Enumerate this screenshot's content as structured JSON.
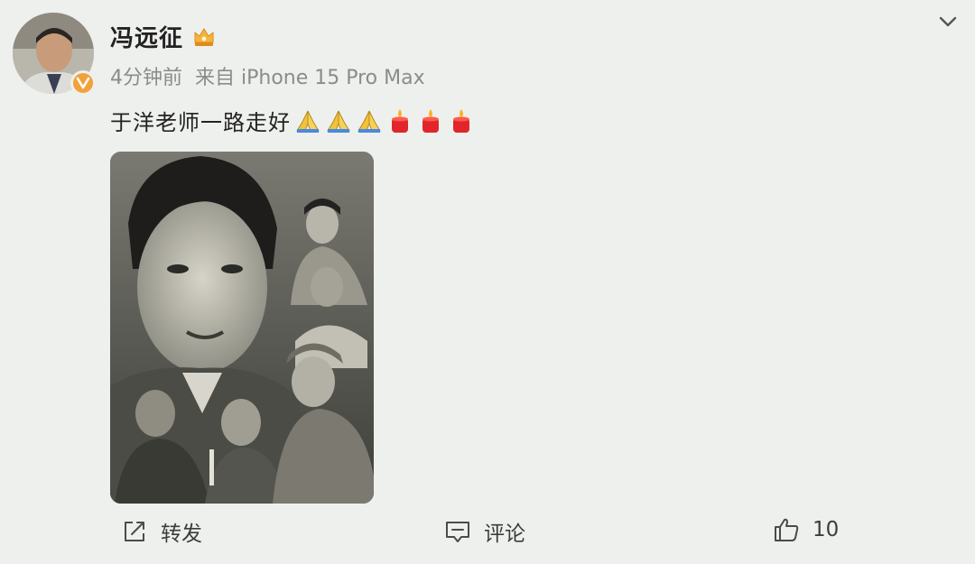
{
  "post": {
    "author": "冯远征",
    "time": "4分钟前",
    "source": "来自 iPhone 15 Pro Max",
    "text": "于洋老师一路走好",
    "emojis": [
      "pray-emoji",
      "pray-emoji",
      "pray-emoji",
      "candle-emoji",
      "candle-emoji",
      "candle-emoji"
    ],
    "photo_icon": "memorial-photo-collage"
  },
  "actions": {
    "repost_label": "转发",
    "comment_label": "评论",
    "like_count": "10"
  },
  "colors": {
    "background": "#eef0ed",
    "verified_badge": "#f2a23a",
    "meta_text": "#8a8c8a",
    "action_icon": "#4a4c4a"
  }
}
